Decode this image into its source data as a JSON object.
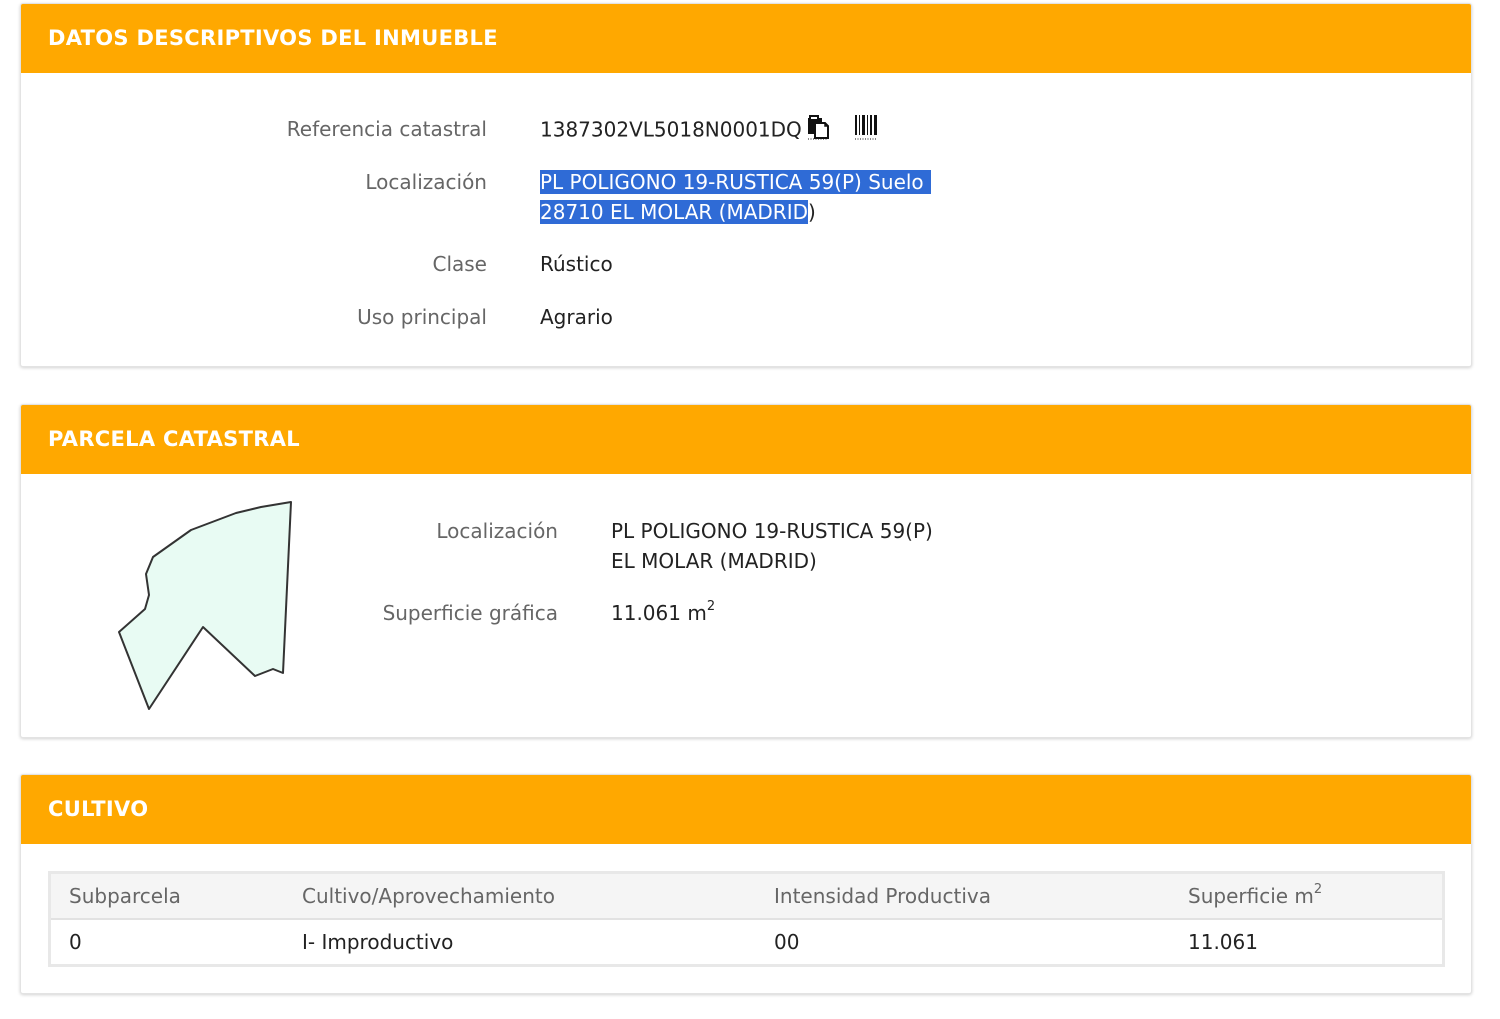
{
  "inmueble": {
    "header": "DATOS DESCRIPTIVOS DEL INMUEBLE",
    "ref_label": "Referencia catastral",
    "ref_value": "1387302VL5018N0001DQ",
    "loc_label": "Localización",
    "loc_line1": "PL POLIGONO 19-RUSTICA 59(P) Suelo",
    "loc_line2_sel": "28710 EL MOLAR (MADRID",
    "loc_line2_rest": ")",
    "clase_label": "Clase",
    "clase_value": "Rústico",
    "uso_label": "Uso principal",
    "uso_value": "Agrario"
  },
  "parcela": {
    "header": "PARCELA CATASTRAL",
    "loc_label": "Localización",
    "loc_line1": "PL POLIGONO 19-RUSTICA 59(P)",
    "loc_line2": "EL MOLAR (MADRID)",
    "sup_label": "Superficie gráfica",
    "sup_value": "11.061 m",
    "sup_exp": "2"
  },
  "cultivo": {
    "header": "CULTIVO",
    "columns": {
      "subparcela": "Subparcela",
      "cultivo": "Cultivo/Aprovechamiento",
      "intensidad": "Intensidad Productiva",
      "superficie": "Superficie m",
      "superficie_exp": "2"
    },
    "rows": [
      {
        "subparcela": "0",
        "cultivo": "I- Improductivo",
        "intensidad": "00",
        "superficie": "11.061"
      }
    ]
  },
  "colors": {
    "header_bg": "#ffa800",
    "selection": "#2f6bd6",
    "parcel_fill": "#e8fbf3"
  },
  "icons": [
    "copy-icon",
    "barcode-icon"
  ]
}
